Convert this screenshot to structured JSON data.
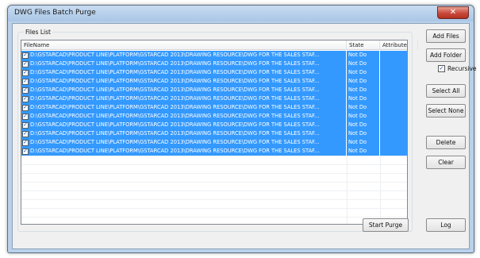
{
  "window": {
    "title": "DWG Files Batch Purge",
    "close_glyph": "✕"
  },
  "files_list": {
    "group_label": "Files List",
    "columns": [
      "FileName",
      "State",
      "Attribute"
    ],
    "rows": [
      {
        "checked": true,
        "file": "D:\\GSTARCAD\\PRODUCT LINE\\PLATFORM\\GSTARCAD 2013\\DRAWING RESOURCE\\DWG FOR THE SALES STAF...",
        "state": "Not Do",
        "attribute": ""
      },
      {
        "checked": true,
        "file": "D:\\GSTARCAD\\PRODUCT LINE\\PLATFORM\\GSTARCAD 2013\\DRAWING RESOURCE\\DWG FOR THE SALES STAF...",
        "state": "Not Do",
        "attribute": ""
      },
      {
        "checked": true,
        "file": "D:\\GSTARCAD\\PRODUCT LINE\\PLATFORM\\GSTARCAD 2013\\DRAWING RESOURCE\\DWG FOR THE SALES STAF...",
        "state": "Not Do",
        "attribute": ""
      },
      {
        "checked": true,
        "file": "D:\\GSTARCAD\\PRODUCT LINE\\PLATFORM\\GSTARCAD 2013\\DRAWING RESOURCE\\DWG FOR THE SALES STAF...",
        "state": "Not Do",
        "attribute": ""
      },
      {
        "checked": true,
        "file": "D:\\GSTARCAD\\PRODUCT LINE\\PLATFORM\\GSTARCAD 2013\\DRAWING RESOURCE\\DWG FOR THE SALES STAF...",
        "state": "Not Do",
        "attribute": ""
      },
      {
        "checked": true,
        "file": "D:\\GSTARCAD\\PRODUCT LINE\\PLATFORM\\GSTARCAD 2013\\DRAWING RESOURCE\\DWG FOR THE SALES STAF...",
        "state": "Not Do",
        "attribute": ""
      },
      {
        "checked": true,
        "file": "D:\\GSTARCAD\\PRODUCT LINE\\PLATFORM\\GSTARCAD 2013\\DRAWING RESOURCE\\DWG FOR THE SALES STAF...",
        "state": "Not Do",
        "attribute": ""
      },
      {
        "checked": true,
        "file": "D:\\GSTARCAD\\PRODUCT LINE\\PLATFORM\\GSTARCAD 2013\\DRAWING RESOURCE\\DWG FOR THE SALES STAF...",
        "state": "Not Do",
        "attribute": ""
      },
      {
        "checked": true,
        "file": "D:\\GSTARCAD\\PRODUCT LINE\\PLATFORM\\GSTARCAD 2013\\DRAWING RESOURCE\\DWG FOR THE SALES STAF...",
        "state": "Not Do",
        "attribute": ""
      },
      {
        "checked": true,
        "file": "D:\\GSTARCAD\\PRODUCT LINE\\PLATFORM\\GSTARCAD 2013\\DRAWING RESOURCE\\DWG FOR THE SALES STAF...",
        "state": "Not Do",
        "attribute": ""
      },
      {
        "checked": true,
        "file": "D:\\GSTARCAD\\PRODUCT LINE\\PLATFORM\\GSTARCAD 2013\\DRAWING RESOURCE\\DWG FOR THE SALES STAF...",
        "state": "Not Do",
        "attribute": ""
      },
      {
        "checked": true,
        "file": "D:\\GSTARCAD\\PRODUCT LINE\\PLATFORM\\GSTARCAD 2013\\DRAWING RESOURCE\\DWG FOR THE SALES STAF...",
        "state": "Not Do",
        "attribute": ""
      }
    ]
  },
  "buttons": {
    "add_files": "Add Files",
    "add_folder": "Add Folder",
    "recursive_label": "Recursive",
    "recursive_checked": true,
    "select_all": "Select All",
    "select_none": "Select None",
    "delete": "Delete",
    "clear": "Clear",
    "start_purge": "Start Purge",
    "log": "Log"
  },
  "glyphs": {
    "check": "✓"
  },
  "colors": {
    "selection": "#3399ff",
    "frame": "#b9d1ea",
    "close": "#c8483a"
  }
}
